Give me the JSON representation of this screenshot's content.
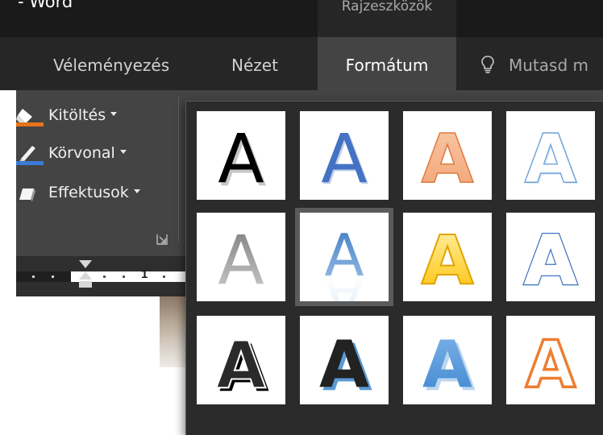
{
  "window": {
    "app_name": "- Word",
    "context_tab": "Rajzeszközök"
  },
  "ribbon_tabs": [
    {
      "label": "Véleményezés"
    },
    {
      "label": "Nézet"
    },
    {
      "label": "Formátum",
      "active": true
    }
  ],
  "tell_me": {
    "label": "Mutasd m",
    "icon": "lightbulb-icon"
  },
  "wordart_group": {
    "buttons": [
      {
        "label": "Kitöltés",
        "icon": "paint-bucket-icon",
        "accent": "#e8731a"
      },
      {
        "label": "Körvonal",
        "icon": "pen-outline-icon",
        "accent": "#3a7bd5"
      },
      {
        "label": "Effektusok",
        "icon": "text-effects-icon"
      }
    ],
    "launcher_icon": "dialog-launcher-icon"
  },
  "ruler": {
    "number": "1"
  },
  "wordart_styles": {
    "letter": "A",
    "selected_index": 5,
    "styles": [
      {
        "name": "Fill: Black, Text color 1; Shadow",
        "icon": "wordart-black-shadow-icon"
      },
      {
        "name": "Fill: Blue, Accent color 1; Shadow",
        "icon": "wordart-blue-shadow-icon"
      },
      {
        "name": "Fill: Orange outline, Accent color 2",
        "icon": "wordart-orange-outline-icon"
      },
      {
        "name": "Fill: White; Outline: Blue",
        "icon": "wordart-white-blue-outline-icon"
      },
      {
        "name": "Gradient Fill: Gray",
        "icon": "wordart-gray-gradient-icon"
      },
      {
        "name": "Fill: Blue; Reflection",
        "icon": "wordart-blue-reflection-icon"
      },
      {
        "name": "Fill: Gold; Outline: Gold",
        "icon": "wordart-gold-icon"
      },
      {
        "name": "Fill: White; Outline: Blue double",
        "icon": "wordart-blue-double-outline-icon"
      },
      {
        "name": "Fill: Black; Outline: White; Shadow",
        "icon": "wordart-black-outline-shadow-icon"
      },
      {
        "name": "Fill: Black; Shadow: Blue",
        "icon": "wordart-black-blue-shadow-icon"
      },
      {
        "name": "Fill: Blue; 3D",
        "icon": "wordart-blue-3d-icon"
      },
      {
        "name": "Fill: White; Outline: Orange",
        "icon": "wordart-orange-white-icon"
      }
    ]
  },
  "colors": {
    "title_bar": "#1a1a1a",
    "tab_bar": "#262626",
    "ribbon": "#444444",
    "gallery_bg": "#2b2b2b",
    "accent_blue": "#4472c4",
    "accent_orange": "#ed7d31",
    "accent_gold": "#ffc000"
  }
}
